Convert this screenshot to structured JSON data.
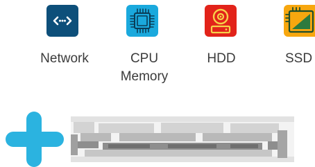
{
  "categories": [
    {
      "key": "network",
      "label": "Network",
      "icon": "network-arrows-icon",
      "color": "#0d4f7a"
    },
    {
      "key": "cpu",
      "label_line1": "CPU",
      "label_line2": "Memory",
      "icon": "cpu-chip-icon",
      "color": "#1aa9dd"
    },
    {
      "key": "hdd",
      "label": "HDD",
      "icon": "hard-disk-icon",
      "color": "#e2231a"
    },
    {
      "key": "ssd",
      "label": "SSD",
      "icon": "ssd-chip-icon",
      "color": "#f7a70f"
    }
  ],
  "add_item": {
    "icon": "plus-icon",
    "color": "#2bb3e0"
  },
  "redacted_text": {
    "icon": "pixelated-text-block"
  }
}
